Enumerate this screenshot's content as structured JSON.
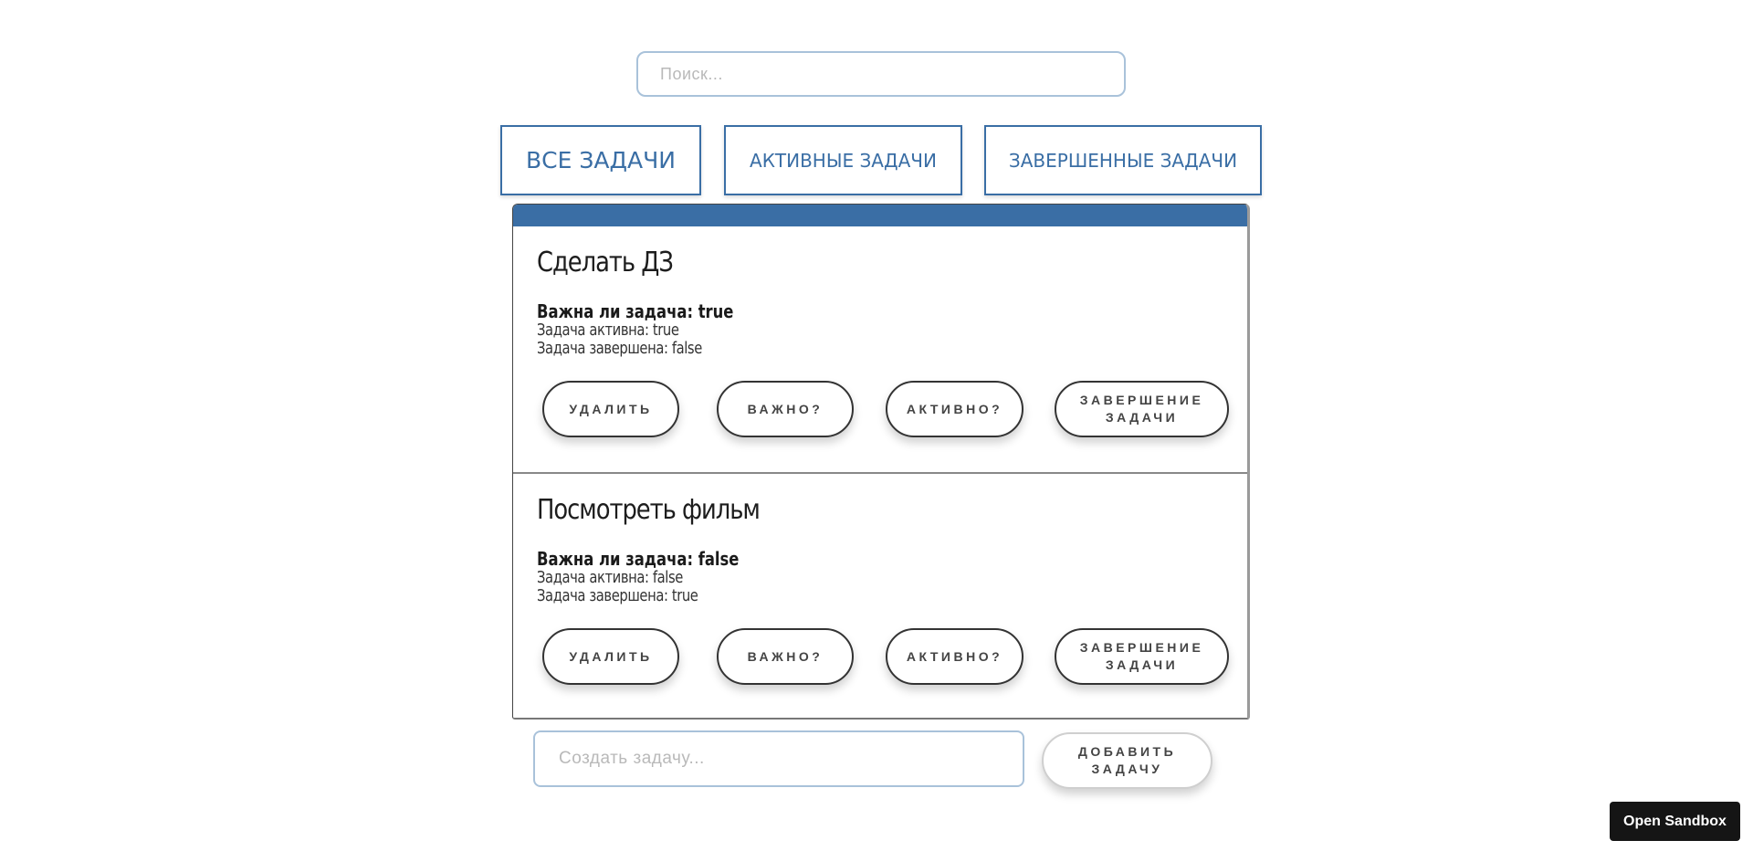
{
  "search": {
    "placeholder": "Поиск...",
    "value": ""
  },
  "filters": {
    "all": "ВСЕ ЗАДАЧИ",
    "active": "АКТИВНЫЕ ЗАДАЧИ",
    "completed": "ЗАВЕРШЕННЫЕ ЗАДАЧИ"
  },
  "tasks": [
    {
      "title": "Сделать ДЗ",
      "important_line": "Важна ли задача: true",
      "active_line": "Задача активна: true",
      "completed_line": "Задача завершена: false",
      "buttons": {
        "delete": "УДАЛИТЬ",
        "important": "ВАЖНО?",
        "active": "АКТИВНО?",
        "complete": "ЗАВЕРШЕНИЕ ЗАДАЧИ"
      }
    },
    {
      "title": "Посмотреть фильм",
      "important_line": "Важна ли задача: false",
      "active_line": "Задача активна: false",
      "completed_line": "Задача завершена: true",
      "buttons": {
        "delete": "УДАЛИТЬ",
        "important": "ВАЖНО?",
        "active": "АКТИВНО?",
        "complete": "ЗАВЕРШЕНИЕ ЗАДАЧИ"
      }
    }
  ],
  "create": {
    "placeholder": "Создать задачу...",
    "value": "",
    "add_label": "ДОБАВИТЬ ЗАДАЧУ"
  },
  "sandbox": {
    "label": "Open Sandbox"
  },
  "colors": {
    "accent": "#3a6ea5",
    "input_border": "#a9c2da",
    "sandbox_bg": "#151515"
  }
}
